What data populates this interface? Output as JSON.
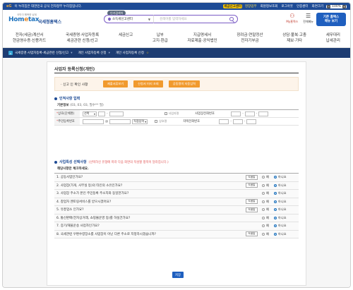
{
  "gov_banner": {
    "logo": "eG",
    "text": "이 누리집은 대한민국 공식 전자정부 누리집입니다.",
    "tools": [
      "세금신고센터",
      "현장업무",
      "회원정보조회",
      "로그아웃",
      "인증센터",
      "화면크기"
    ],
    "zoom": "100%"
  },
  "header": {
    "logo_top": "국민이 행복한 납세",
    "logo_home": "Hom",
    "logo_accent": "e",
    "logo_tax": "tax",
    "logo_kr": "국세청홈택스",
    "cert_badge": "인기검색어",
    "location": "소득세신고센터",
    "search_placeholder": "검색어를 입력하세요",
    "my_label": "My홈택스",
    "menu_label": "전체메뉴",
    "mobile_line1": "기존 홈택스",
    "mobile_line2": "메뉴 보기"
  },
  "gnb": [
    {
      "line1": "전자(세금)계산서",
      "line2": "현금영수증·신용카드"
    },
    {
      "line1": "국세증명·사업자등록",
      "line2": "세금관련 신청/신고"
    },
    {
      "line1": "세금신고",
      "line2": ""
    },
    {
      "line1": "납부",
      "line2": "고지·환급"
    },
    {
      "line1": "지급명세서",
      "line2": "자료제출·공익법인"
    },
    {
      "line1": "장려금·연말정산",
      "line2": "전자기부금"
    },
    {
      "line1": "상담·불복·고충",
      "line2": "제보·기타"
    },
    {
      "line1": "세무대리",
      "line2": "납세관리"
    }
  ],
  "subnav": {
    "crumb1": "국세증명·사업자등록·세금관련 신청/신고",
    "crumb2": "개인 사업자등록 신청",
    "crumb3": "개인 사업자등록 신청"
  },
  "page": {
    "title": "사업자 등록신청(개인)",
    "cert_label": "신고 인 확인 사항",
    "cert_buttons": [
      "제출서류보기",
      "신청서 미리 조회",
      "공동명의 자동입력"
    ],
    "personal_heading": "인적사항 입력",
    "basic_info": "기본정보",
    "basic_info_note": "(03, 03, 03, 필수** 필)",
    "personal_fields": {
      "row1_left": "상호(단체명)",
      "row1_select": "선택",
      "row1_check": "사업자명",
      "row1_right": "사업장전화번호",
      "row2_left": "주민등록번호",
      "row2_select": "직접입력",
      "row2_check": "상호명",
      "row2_right": "자택전화번호"
    },
    "select_heading": "사업특성 선택사항",
    "select_note": "(선택하신 유형에 따라 다음 화면의 작성할 항목이 달라집니다.)",
    "question_heading": "해당사항만 체크하세요.",
    "questions": [
      {
        "text": "1. 공동사업인가요?",
        "help": "도움말"
      },
      {
        "text": "2. 사업장(가게, 사무실 등)의 타인의 소유인가요?",
        "help": "도움말"
      },
      {
        "text": "3. 사업장 주소가 본인 주민등록 주소지와 동일한가요?",
        "help": ""
      },
      {
        "text": "4. 창업자 멘토링서비스를 받으시겠어요?",
        "help": "도움말"
      },
      {
        "text": "5. 유흥업소 인가요?",
        "help": "도움말"
      },
      {
        "text": "6. 통신판매(전자상거래, 쇼핑몰운영 등)를 하실건가요?",
        "help": ""
      },
      {
        "text": "7. 증기/재물운송 사업자인가요?",
        "help": ""
      },
      {
        "text": "8. 국세관련 우편수령장소를 사업장이 아닌 다른 주소로 지정하시겠습니까?",
        "help": "도움말"
      }
    ],
    "yes_label": "예",
    "no_label": "아니요",
    "save_label": "저장"
  }
}
